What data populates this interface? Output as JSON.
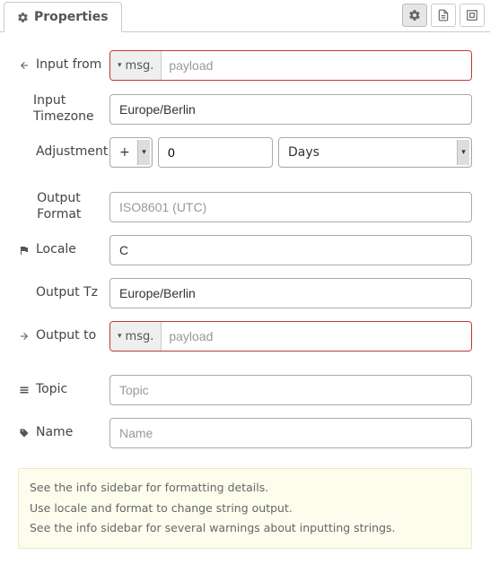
{
  "tab": {
    "title": "Properties"
  },
  "fields": {
    "inputFrom": {
      "label": "Input from",
      "typePrefix": "msg.",
      "value": "",
      "placeholder": "payload"
    },
    "inputTz": {
      "label": "Input Timezone",
      "value": "Europe/Berlin"
    },
    "adjustment": {
      "label": "Adjustment",
      "sign": "+",
      "amount": "0",
      "unit": "Days"
    },
    "outFormat": {
      "label": "Output Format",
      "value": "",
      "placeholder": "ISO8601 (UTC)"
    },
    "locale": {
      "label": "Locale",
      "value": "C"
    },
    "outputTz": {
      "label": "Output Tz",
      "value": "Europe/Berlin"
    },
    "outputTo": {
      "label": "Output to",
      "typePrefix": "msg.",
      "value": "",
      "placeholder": "payload"
    },
    "topic": {
      "label": "Topic",
      "value": "",
      "placeholder": "Topic"
    },
    "name": {
      "label": "Name",
      "value": "",
      "placeholder": "Name"
    }
  },
  "note": {
    "line1": "See the info sidebar for formatting details.",
    "line2": "Use locale and format to change string output.",
    "line3": "See the info sidebar for several warnings about inputting strings."
  }
}
